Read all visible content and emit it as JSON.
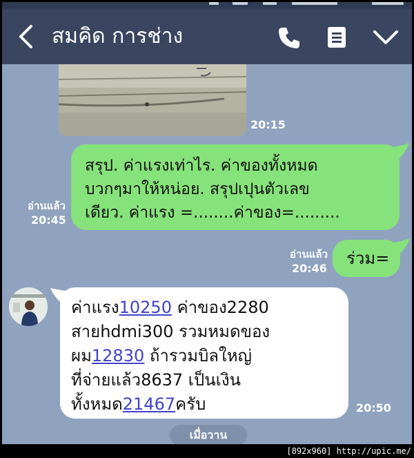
{
  "header": {
    "contact_name": "สมคิด การช่าง",
    "icons": [
      "back-arrow-icon",
      "phone-icon",
      "note-icon",
      "chevron-down-icon"
    ],
    "background": "#3a4660"
  },
  "messages": {
    "image_time": "20:15",
    "msg1": {
      "lines": [
        "สรุป. ค่าแรงเท่าไร.  ค่าของทั้งหมด",
        "บวกๆมาให้หน่อย.  สรุปเปุนตัวเลข",
        "เดียว. ค่าแรง =........ค่าของ=........."
      ],
      "read_label": "อ่านแล้ว",
      "time": "20:45"
    },
    "msg2": {
      "text": "ร่วม=",
      "read_label": "อ่านแล้ว",
      "time": "20:46"
    },
    "msg3": {
      "line1_pre": "ค่าแรง",
      "line1_link": "10250",
      "line1_post": " ค่าของ2280",
      "line2": "สายhdmi300 รวมหมดของ",
      "line3_pre": "ผม",
      "line3_link": "12830",
      "line3_post": " ถ้ารวมบิลใหญ่",
      "line4": "ที่จ่ายแล้ว8637 เป็นเงิน",
      "line5_pre": "ทั้งหมด",
      "line5_link": "21467",
      "line5_post": "ครับ",
      "time": "20:50"
    }
  },
  "date_separator": "เมื่อวาน",
  "watermark": "[892x960] http://upic.me/",
  "colors": {
    "chat_bg": "#8fa3be",
    "outgoing_bubble": "#86e27a",
    "incoming_bubble": "#ffffff",
    "link": "#3f44c8"
  }
}
